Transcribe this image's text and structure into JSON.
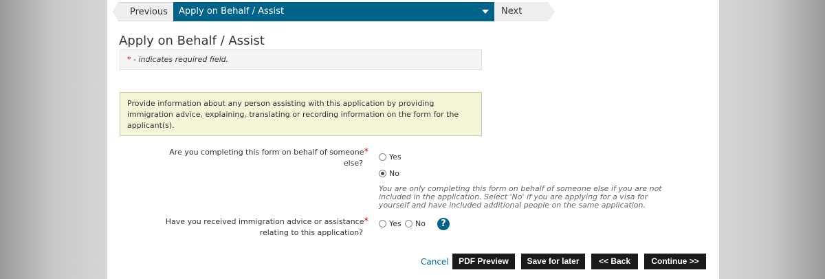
{
  "nav": {
    "previous_label": "Previous",
    "current_label": "Apply on Behalf / Assist",
    "next_label": "Next"
  },
  "page_title": "Apply on Behalf / Assist",
  "required_note": {
    "star": "*",
    "text": "- indicates required field."
  },
  "info_text": "Provide information about any person assisting with this application by providing immigration advice, explaining, translating or recording information on the form for the applicant(s).",
  "q1": {
    "label_line1": "Are you completing this form on behalf of someone",
    "label_line2": "else?",
    "star": "*",
    "options": {
      "yes": "Yes",
      "no": "No"
    },
    "selected": "No",
    "hint": "You are only completing this form on behalf of someone else if you are not included in the application. Select 'No' if you are applying for a visa for yourself and have included additional people on the same application."
  },
  "q2": {
    "label_line1": "Have you received immigration advice or assistance",
    "label_line2": "relating to this application?",
    "star": "*",
    "options": {
      "yes": "Yes",
      "no": "No"
    },
    "help_icon": "?"
  },
  "actions": {
    "cancel": "Cancel",
    "pdf_preview": "PDF Preview",
    "save_for_later": "Save for later",
    "back": "<< Back",
    "continue": "Continue >>"
  },
  "colors": {
    "accent": "#00638a",
    "button_bg": "#1a1a1a",
    "info_bg": "#f5f5d8",
    "required": "#dd0000"
  }
}
